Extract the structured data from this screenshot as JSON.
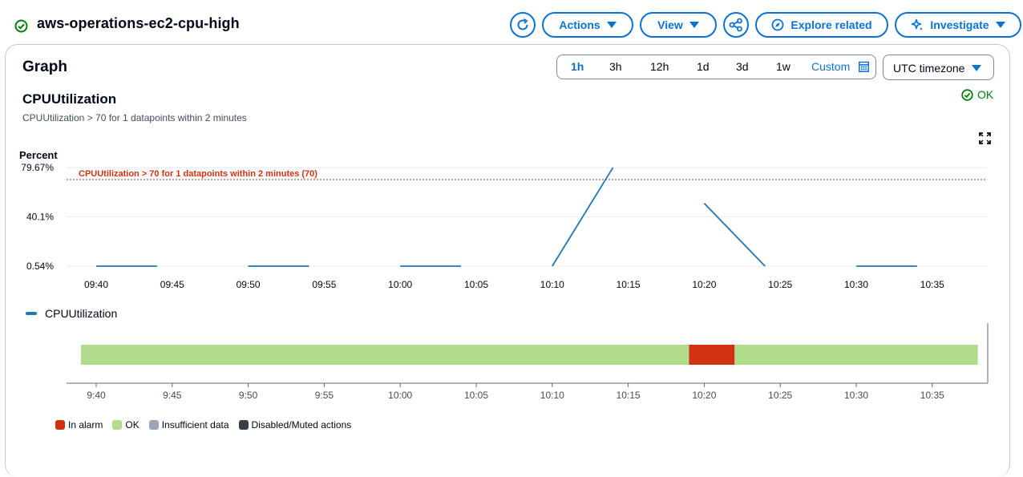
{
  "alarm": {
    "name": "aws-operations-ec2-cpu-high"
  },
  "toolbar": {
    "actions_label": "Actions",
    "view_label": "View",
    "explore_label": "Explore related",
    "investigate_label": "Investigate"
  },
  "graph": {
    "heading": "Graph",
    "time_ranges": [
      "1h",
      "3h",
      "12h",
      "1d",
      "3d",
      "1w"
    ],
    "selected_range": "1h",
    "custom_label": "Custom",
    "timezone": "UTC timezone",
    "metric_title": "CPUUtilization",
    "metric_description": "CPUUtilization > 70 for 1 datapoints within 2 minutes",
    "status": "OK",
    "legend_label": "CPUUtilization"
  },
  "chart_data": {
    "type": "line",
    "ylabel": "Percent",
    "ylim": [
      0.54,
      79.67
    ],
    "y_ticks": [
      "79.67%",
      "40.1%",
      "0.54%"
    ],
    "x_ticks": [
      "09:40",
      "09:45",
      "09:50",
      "09:55",
      "10:00",
      "10:05",
      "10:10",
      "10:15",
      "10:20",
      "10:25",
      "10:30",
      "10:35"
    ],
    "threshold": {
      "label": "CPUUtilization > 70 for 1 datapoints within 2 minutes (70)",
      "value": 70,
      "color": "#d13212"
    },
    "series": [
      {
        "name": "CPUUtilization",
        "color": "#1f77b4",
        "segments": [
          [
            [
              "09:40",
              0.54
            ],
            [
              "09:44",
              0.54
            ]
          ],
          [
            [
              "09:50",
              0.54
            ],
            [
              "09:54",
              0.54
            ]
          ],
          [
            [
              "10:00",
              0.54
            ],
            [
              "10:04",
              0.54
            ]
          ],
          [
            [
              "10:10",
              0.54
            ],
            [
              "10:14",
              79.67
            ]
          ],
          [
            [
              "10:20",
              51.0
            ],
            [
              "10:24",
              0.54
            ]
          ],
          [
            [
              "10:30",
              0.54
            ],
            [
              "10:34",
              0.54
            ]
          ]
        ]
      }
    ],
    "state_timeline": {
      "x_ticks": [
        "9:40",
        "9:45",
        "9:50",
        "9:55",
        "10:00",
        "10:05",
        "10:10",
        "10:15",
        "10:20",
        "10:25",
        "10:30",
        "10:35"
      ],
      "states": [
        {
          "state": "ok",
          "from": "09:39",
          "to": "10:19"
        },
        {
          "state": "in-alarm",
          "from": "10:19",
          "to": "10:22"
        },
        {
          "state": "ok",
          "from": "10:22",
          "to": "10:38"
        }
      ],
      "colors": {
        "in_alarm": "#d13212",
        "ok": "#b0dc8c",
        "insufficient": "#9ba7b6",
        "disabled": "#353f49"
      },
      "legend": [
        "In alarm",
        "OK",
        "Insufficient data",
        "Disabled/Muted actions"
      ]
    }
  }
}
